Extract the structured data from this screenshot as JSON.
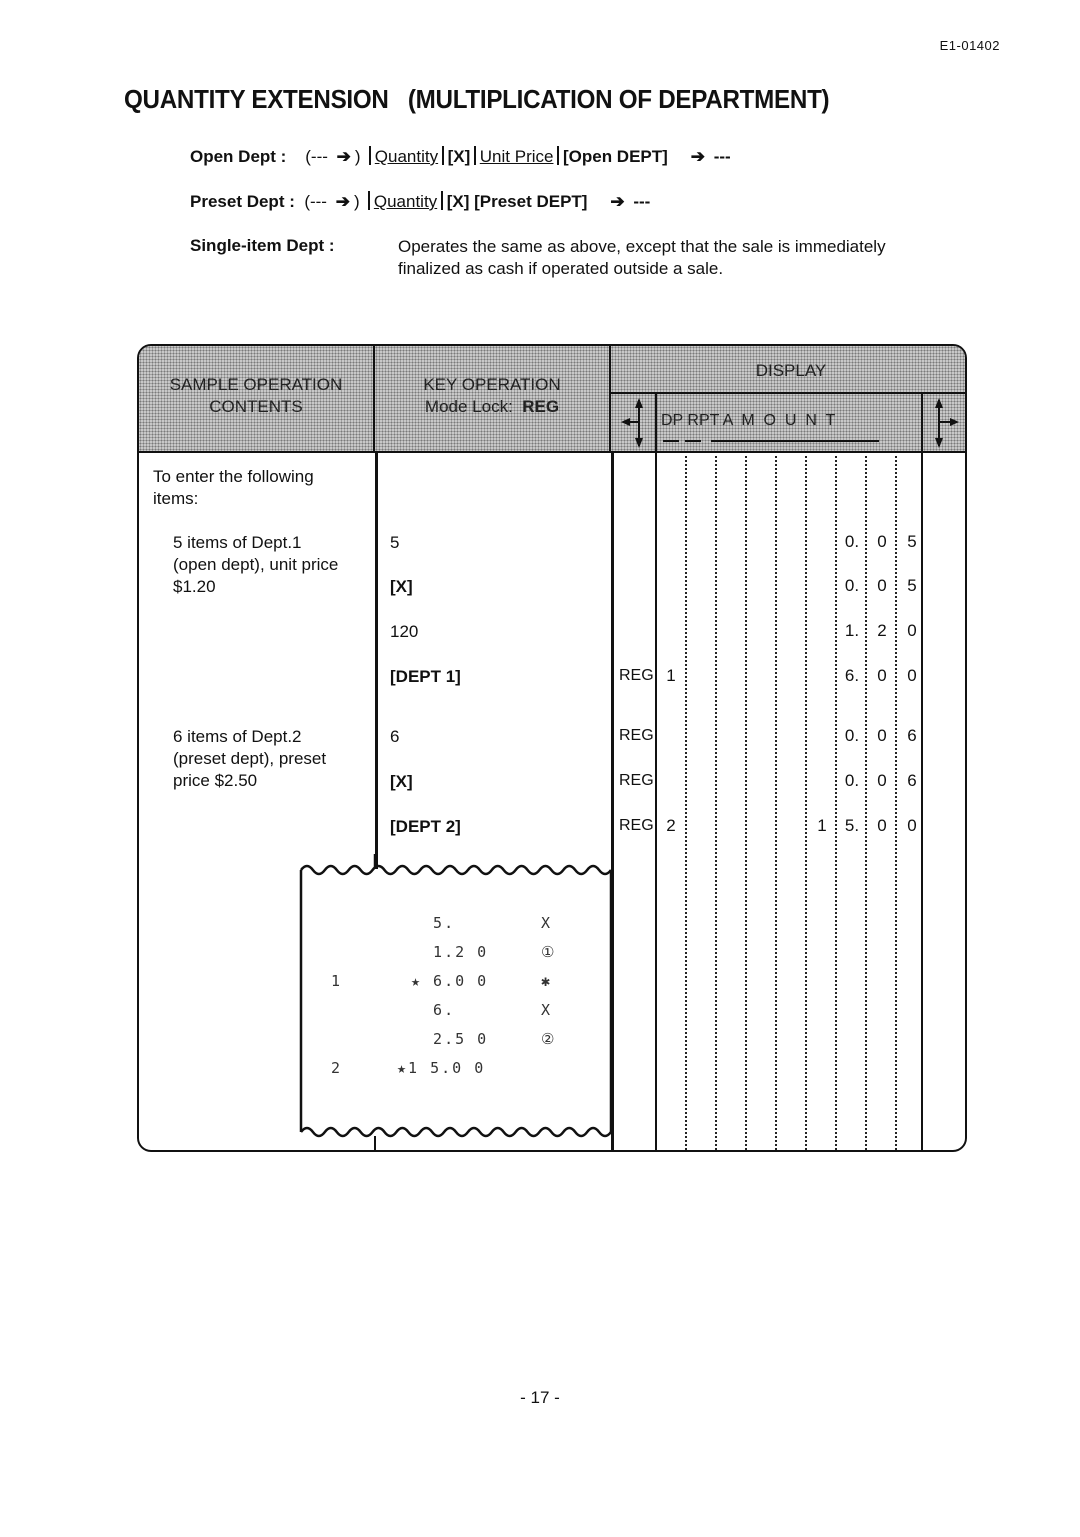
{
  "document_id": "E1-01402",
  "title": "QUANTITY EXTENSION   (MULTIPLICATION OF DEPARTMENT)",
  "syntax": {
    "open_dept": {
      "label": "Open Dept :",
      "prefix": "(---",
      "close_paren": ")",
      "quantity": "Quantity",
      "x_key": "[X]",
      "unit_price": "Unit Price",
      "dept_key": "[Open DEPT]",
      "suffix": "---"
    },
    "preset_dept": {
      "label": "Preset Dept :",
      "prefix": "(---",
      "close_paren": ")",
      "quantity": "Quantity",
      "x_key": "[X]",
      "dept_key": "[Preset DEPT]",
      "suffix": "---"
    },
    "single_item": {
      "label": "Single-item Dept :",
      "description_line1": "Operates the same as above, except that the sale is immediately",
      "description_line2": "finalized as cash if operated outside a sale."
    }
  },
  "table": {
    "headers": {
      "sample_line1": "SAMPLE OPERATION",
      "sample_line2": "CONTENTS",
      "key_line1": "KEY OPERATION",
      "key_line2_prefix": "Mode Lock:",
      "key_line2_mode": "REG",
      "display": "DISPLAY",
      "display_sub": "DP RPT A  M  O  U  N  T"
    },
    "intro": [
      "To enter the following",
      "items:"
    ],
    "groups": [
      {
        "description": [
          "5 items of Dept.1",
          "(open dept), unit price",
          "$1.20"
        ],
        "steps": [
          {
            "key": "5",
            "bold": false,
            "mode": "",
            "dp": "",
            "amount": [
              "",
              "",
              "",
              "",
              "",
              "0.",
              "0",
              "5"
            ]
          },
          {
            "key": "[X]",
            "bold": true,
            "mode": "",
            "dp": "",
            "amount": [
              "",
              "",
              "",
              "",
              "",
              "0.",
              "0",
              "5"
            ]
          },
          {
            "key": "120",
            "bold": false,
            "mode": "",
            "dp": "",
            "amount": [
              "",
              "",
              "",
              "",
              "",
              "1.",
              "2",
              "0"
            ]
          },
          {
            "key": "[DEPT 1]",
            "bold": true,
            "mode": "REG",
            "dp": "1",
            "amount": [
              "",
              "",
              "",
              "",
              "",
              "6.",
              "0",
              "0"
            ]
          }
        ]
      },
      {
        "description": [
          "6 items of Dept.2",
          "(preset dept), preset",
          "price $2.50"
        ],
        "steps": [
          {
            "key": "6",
            "bold": false,
            "mode": "REG",
            "dp": "",
            "amount": [
              "",
              "",
              "",
              "",
              "",
              "0.",
              "0",
              "6"
            ]
          },
          {
            "key": "[X]",
            "bold": true,
            "mode": "REG",
            "dp": "",
            "amount": [
              "",
              "",
              "",
              "",
              "",
              "0.",
              "0",
              "6"
            ]
          },
          {
            "key": "[DEPT 2]",
            "bold": true,
            "mode": "REG",
            "dp": "2",
            "amount": [
              "",
              "",
              "",
              "",
              "1",
              "5.",
              "0",
              "0"
            ]
          }
        ]
      }
    ],
    "receipt": [
      {
        "dept": "",
        "amount": "  5.  ",
        "symbol": "X"
      },
      {
        "dept": "",
        "amount": "  1.2 0",
        "symbol": "①"
      },
      {
        "dept": "1",
        "amount": "★ 6.0 0",
        "symbol": "✱"
      },
      {
        "dept": "",
        "amount": "  6.  ",
        "symbol": "X"
      },
      {
        "dept": "",
        "amount": "  2.5 0",
        "symbol": "②"
      },
      {
        "dept": "2",
        "amount": "★1 5.0 0",
        "symbol": ""
      }
    ]
  },
  "page_number": "- 17 -"
}
